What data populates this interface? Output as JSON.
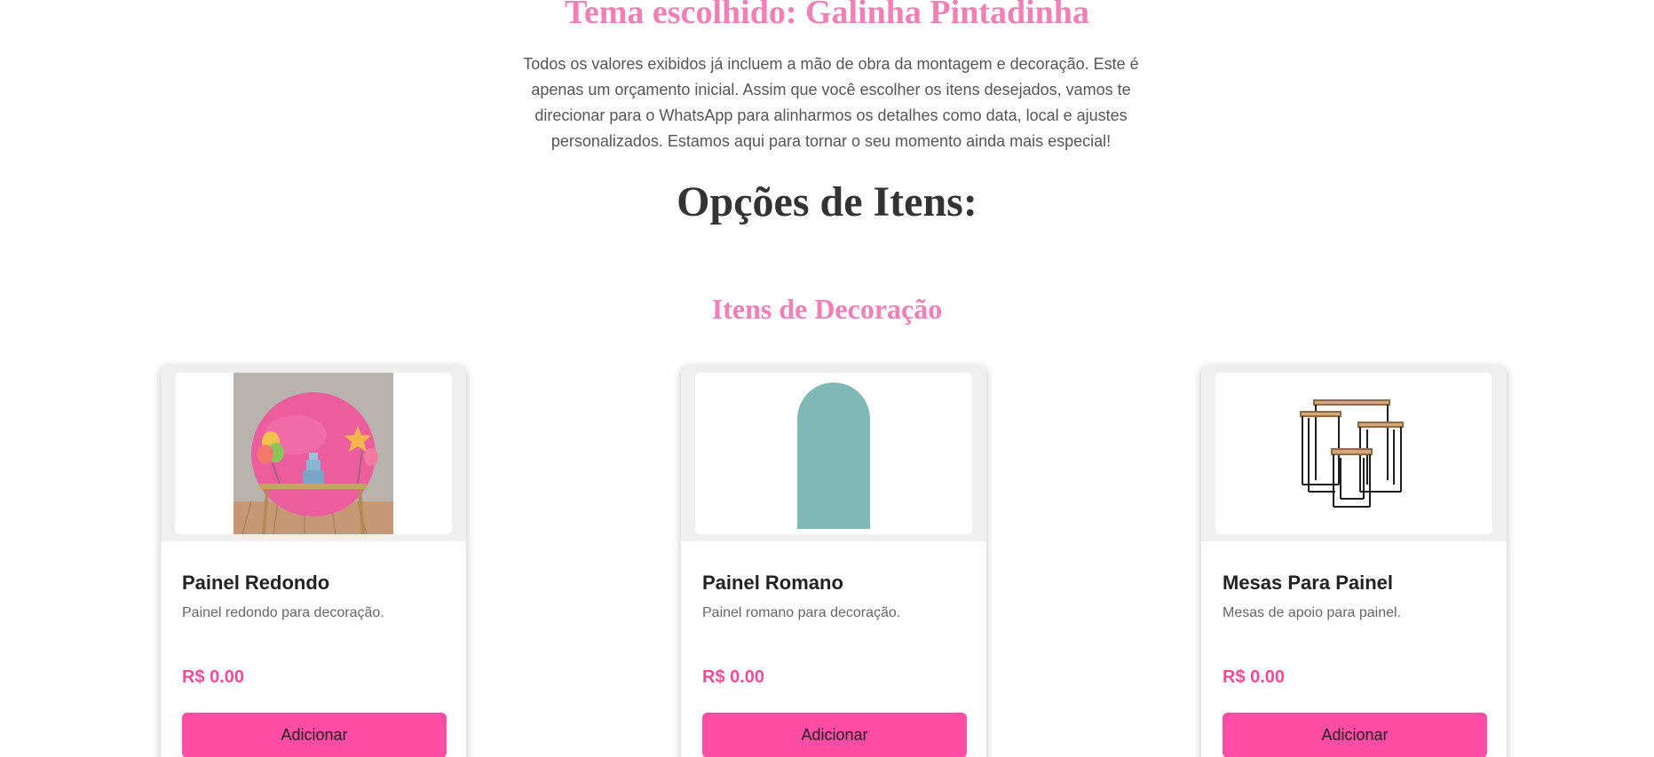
{
  "header": {
    "theme_title": "Tema escolhido: Galinha Pintadinha",
    "intro_text": "Todos os valores exibidos já incluem a mão de obra da montagem e decoração. Este é apenas um orçamento inicial. Assim que você escolher os itens desejados, vamos te direcionar para o WhatsApp para alinharmos os detalhes como data, local e ajustes personalizados. Estamos aqui para tornar o seu momento ainda mais especial!"
  },
  "options_title": "Opções de Itens:",
  "section": {
    "title": "Itens de Decoração"
  },
  "items": [
    {
      "title": "Painel Redondo",
      "description": "Painel redondo para decoração.",
      "price": "R$ 0.00",
      "button_label": "Adicionar",
      "image_icon": "round-panel-photo"
    },
    {
      "title": "Painel Romano",
      "description": "Painel romano para decoração.",
      "price": "R$ 0.00",
      "button_label": "Adicionar",
      "image_icon": "arch-panel-photo"
    },
    {
      "title": "Mesas Para Painel",
      "description": "Mesas de apoio para painel.",
      "price": "R$ 0.00",
      "button_label": "Adicionar",
      "image_icon": "nesting-tables-photo"
    }
  ],
  "colors": {
    "accent_pink": "#f27fb5",
    "button_pink": "#ff4da6",
    "price_pink": "#ef4d9b"
  }
}
